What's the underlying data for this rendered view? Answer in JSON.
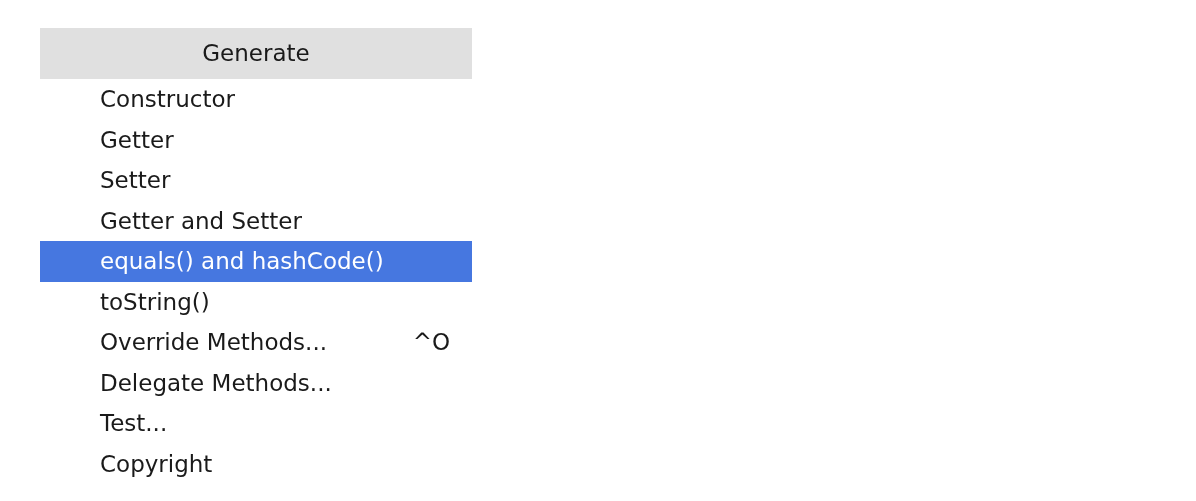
{
  "menu": {
    "title": "Generate",
    "items": [
      {
        "label": "Constructor",
        "selected": false
      },
      {
        "label": "Getter",
        "selected": false
      },
      {
        "label": "Setter",
        "selected": false
      },
      {
        "label": "Getter and Setter",
        "selected": false
      },
      {
        "label": "equals() and hashCode()",
        "selected": true
      },
      {
        "label": "toString()",
        "selected": false
      },
      {
        "label": "Override Methods...",
        "shortcut": "^O",
        "selected": false
      },
      {
        "label": "Delegate Methods...",
        "selected": false
      },
      {
        "label": "Test...",
        "selected": false
      },
      {
        "label": "Copyright",
        "selected": false
      }
    ]
  }
}
